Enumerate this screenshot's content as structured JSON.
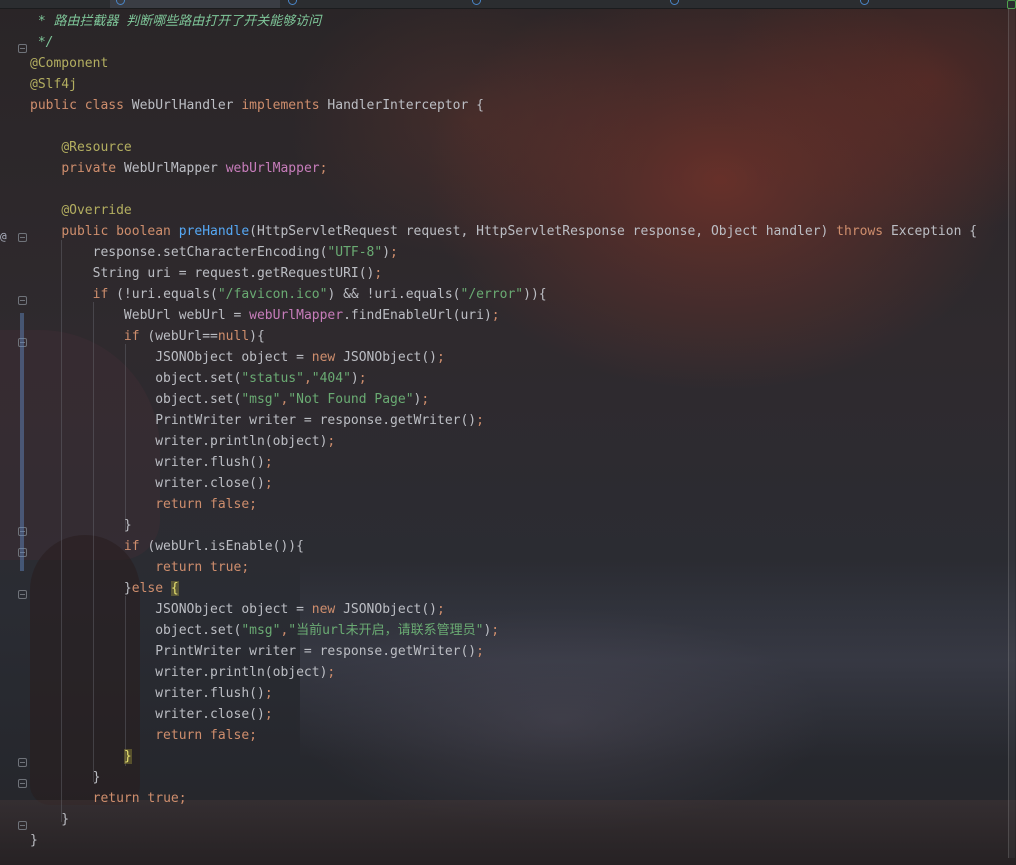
{
  "theme": {
    "comment": "#7ec699",
    "keyword": "#cf8e6d",
    "annotation": "#b3ae60",
    "method": "#56a8f5",
    "string": "#6aab73",
    "field": "#c77dbb",
    "text": "#bcbec4",
    "accent": "#3574f0"
  },
  "editor_tabs": [
    {
      "icon": "file-icon",
      "active": false
    },
    {
      "icon": "class-icon",
      "active": true
    },
    {
      "icon": "class-icon",
      "active": false
    },
    {
      "icon": "class-icon",
      "active": false
    },
    {
      "icon": "class-icon",
      "active": false
    },
    {
      "icon": "class-icon",
      "active": false
    }
  ],
  "code_lines": [
    [
      [
        "c",
        " * 路由拦截器 判断哪些路由打开了开关能够访问"
      ]
    ],
    [
      [
        "c",
        " */"
      ]
    ],
    [
      [
        "a",
        "@Component"
      ]
    ],
    [
      [
        "a",
        "@Slf4j"
      ]
    ],
    [
      [
        "k",
        "public class "
      ],
      [
        "n",
        "WebUrlHandler "
      ],
      [
        "k",
        "implements "
      ],
      [
        "n",
        "HandlerInterceptor {"
      ]
    ],
    [
      [
        "n",
        ""
      ]
    ],
    [
      [
        "n",
        "    "
      ],
      [
        "a",
        "@Resource"
      ]
    ],
    [
      [
        "n",
        "    "
      ],
      [
        "k",
        "private "
      ],
      [
        "n",
        "WebUrlMapper "
      ],
      [
        "v",
        "webUrlMapper"
      ],
      [
        "k",
        ";"
      ]
    ],
    [
      [
        "n",
        ""
      ]
    ],
    [
      [
        "n",
        "    "
      ],
      [
        "a",
        "@Override"
      ]
    ],
    [
      [
        "n",
        "    "
      ],
      [
        "k",
        "public boolean "
      ],
      [
        "f",
        "preHandle"
      ],
      [
        "n",
        "(HttpServletRequest request, HttpServletResponse response, Object handler) "
      ],
      [
        "k",
        "throws "
      ],
      [
        "n",
        "Exception {"
      ]
    ],
    [
      [
        "n",
        "        response.setCharacterEncoding("
      ],
      [
        "s",
        "\"UTF-8\""
      ],
      [
        "n",
        ")"
      ],
      [
        "k",
        ";"
      ]
    ],
    [
      [
        "n",
        "        String uri = request.getRequestURI()"
      ],
      [
        "k",
        ";"
      ]
    ],
    [
      [
        "n",
        "        "
      ],
      [
        "k",
        "if "
      ],
      [
        "n",
        "(!uri.equals("
      ],
      [
        "s",
        "\"/favicon.ico\""
      ],
      [
        "n",
        ") && !uri.equals("
      ],
      [
        "s",
        "\"/error\""
      ],
      [
        "n",
        ")){"
      ]
    ],
    [
      [
        "n",
        "            WebUrl webUrl = "
      ],
      [
        "v",
        "webUrlMapper"
      ],
      [
        "n",
        ".findEnableUrl(uri)"
      ],
      [
        "k",
        ";"
      ]
    ],
    [
      [
        "n",
        "            "
      ],
      [
        "k",
        "if "
      ],
      [
        "n",
        "(webUrl=="
      ],
      [
        "k",
        "null"
      ],
      [
        "n",
        "){"
      ]
    ],
    [
      [
        "n",
        "                JSONObject object = "
      ],
      [
        "k",
        "new "
      ],
      [
        "n",
        "JSONObject()"
      ],
      [
        "k",
        ";"
      ]
    ],
    [
      [
        "n",
        "                object.set("
      ],
      [
        "s",
        "\"status\""
      ],
      [
        "k",
        ","
      ],
      [
        "s",
        "\"404\""
      ],
      [
        "n",
        ")"
      ],
      [
        "k",
        ";"
      ]
    ],
    [
      [
        "n",
        "                object.set("
      ],
      [
        "s",
        "\"msg\""
      ],
      [
        "k",
        ","
      ],
      [
        "s",
        "\"Not Found Page\""
      ],
      [
        "n",
        ")"
      ],
      [
        "k",
        ";"
      ]
    ],
    [
      [
        "n",
        "                PrintWriter writer = response.getWriter()"
      ],
      [
        "k",
        ";"
      ]
    ],
    [
      [
        "n",
        "                writer.println(object)"
      ],
      [
        "k",
        ";"
      ]
    ],
    [
      [
        "n",
        "                writer.flush()"
      ],
      [
        "k",
        ";"
      ]
    ],
    [
      [
        "n",
        "                writer.close()"
      ],
      [
        "k",
        ";"
      ]
    ],
    [
      [
        "n",
        "                "
      ],
      [
        "k",
        "return false;"
      ]
    ],
    [
      [
        "n",
        "            }"
      ]
    ],
    [
      [
        "n",
        "            "
      ],
      [
        "k",
        "if "
      ],
      [
        "n",
        "(webUrl.isEnable()){"
      ]
    ],
    [
      [
        "n",
        "                "
      ],
      [
        "k",
        "return true;"
      ]
    ],
    [
      [
        "n",
        "            }"
      ],
      [
        "k",
        "else "
      ],
      [
        "hl",
        "{"
      ]
    ],
    [
      [
        "n",
        "                JSONObject object = "
      ],
      [
        "k",
        "new "
      ],
      [
        "n",
        "JSONObject()"
      ],
      [
        "k",
        ";"
      ]
    ],
    [
      [
        "n",
        "                object.set("
      ],
      [
        "s",
        "\"msg\""
      ],
      [
        "k",
        ","
      ],
      [
        "s",
        "\"当前url未开启，请联系管理员\""
      ],
      [
        "n",
        ")"
      ],
      [
        "k",
        ";"
      ]
    ],
    [
      [
        "n",
        "                PrintWriter writer = response.getWriter()"
      ],
      [
        "k",
        ";"
      ]
    ],
    [
      [
        "n",
        "                writer.println(object)"
      ],
      [
        "k",
        ";"
      ]
    ],
    [
      [
        "n",
        "                writer.flush()"
      ],
      [
        "k",
        ";"
      ]
    ],
    [
      [
        "n",
        "                writer.close()"
      ],
      [
        "k",
        ";"
      ]
    ],
    [
      [
        "n",
        "                "
      ],
      [
        "k",
        "return false;"
      ]
    ],
    [
      [
        "n",
        "            "
      ],
      [
        "hl",
        "}"
      ]
    ],
    [
      [
        "n",
        "        }"
      ]
    ],
    [
      [
        "n",
        "        "
      ],
      [
        "k",
        "return true;"
      ]
    ],
    [
      [
        "n",
        "    }"
      ]
    ],
    [
      [
        "n",
        "}"
      ]
    ]
  ],
  "gutter": {
    "override_marker": "@"
  }
}
